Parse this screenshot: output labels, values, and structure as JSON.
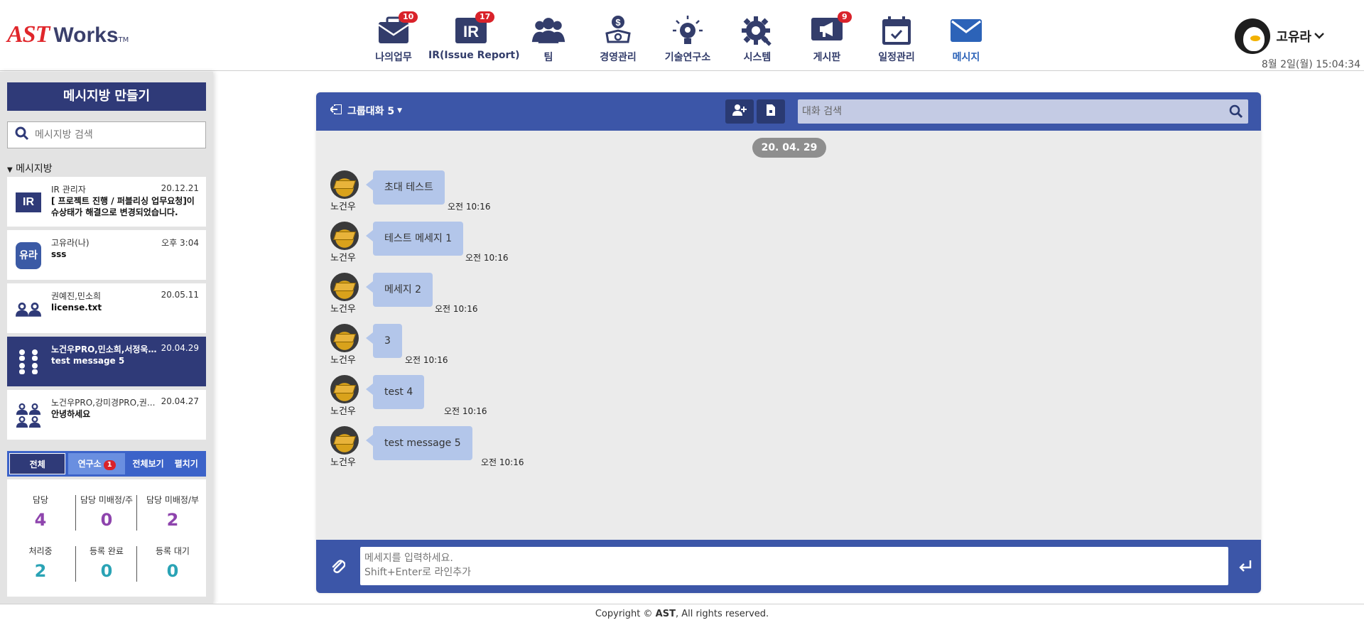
{
  "app": {
    "logo_main": "AST",
    "logo_works": "Works",
    "logo_tm": "TM"
  },
  "nav": [
    {
      "label": "나의업무",
      "badge": "10",
      "icon": "briefcase-icon"
    },
    {
      "label": "IR(Issue Report)",
      "badge": "17",
      "icon": "ir-icon"
    },
    {
      "label": "팀",
      "badge": "",
      "icon": "team-icon"
    },
    {
      "label": "경영관리",
      "badge": "",
      "icon": "management-icon"
    },
    {
      "label": "기술연구소",
      "badge": "",
      "icon": "research-icon"
    },
    {
      "label": "시스템",
      "badge": "",
      "icon": "gear-wrench-icon"
    },
    {
      "label": "게시판",
      "badge": "9",
      "icon": "megaphone-icon"
    },
    {
      "label": "일정관리",
      "badge": "",
      "icon": "calendar-icon"
    },
    {
      "label": "메시지",
      "badge": "",
      "icon": "mail-icon",
      "active": true
    }
  ],
  "user": {
    "name": "고유라",
    "clock": "8월 2일(월) 15:04:34"
  },
  "sidebar": {
    "make_room": "메시지방 만들기",
    "search_placeholder": "메시지방 검색",
    "section_label": "메시지방",
    "rooms": [
      {
        "name": "IR 관리자",
        "date": "20.12.21",
        "message": "[ 프로젝트 진행 / 퍼블리싱 업무요청]이 슈상태가 해결으로 변경되었습니다.",
        "icon_text": "IR",
        "active": false
      },
      {
        "name": "고유라(나)",
        "date": "오후 3:04",
        "message": "sss",
        "icon_text": "유라",
        "active": false
      },
      {
        "name": "권예진,민소희",
        "date": "20.05.11",
        "message": "license.txt",
        "icon_text": "",
        "active": false
      },
      {
        "name": "노건우PRO,민소희,서정욱...",
        "date": "20.04.29",
        "message": "test message 5",
        "icon_text": "",
        "active": true
      },
      {
        "name": "노건우PRO,강미경PRO,권...",
        "date": "20.04.27",
        "message": "안녕하세요",
        "icon_text": "",
        "active": false
      }
    ],
    "tabs": {
      "all": "전체",
      "lab": "연구소",
      "lab_badge": "1",
      "view_all": "전체보기",
      "expand": "펼치기"
    },
    "stats": [
      {
        "label": "담당",
        "value": "4"
      },
      {
        "label": "담당 미배정/주",
        "value": "0"
      },
      {
        "label": "담당 미배정/부",
        "value": "2"
      },
      {
        "label": "처리중",
        "value": "2"
      },
      {
        "label": "등록 완료",
        "value": "0"
      },
      {
        "label": "등록 대기",
        "value": "0"
      }
    ]
  },
  "chat": {
    "title": "그룹대화 5",
    "search_placeholder": "대화 검색",
    "date": "20. 04. 29",
    "messages": [
      {
        "sender": "노건우",
        "text": "초대 테스트",
        "time": "오전 10:16"
      },
      {
        "sender": "노건우",
        "text": "테스트 메세지 1",
        "time": "오전 10:16"
      },
      {
        "sender": "노건우",
        "text": "메세지 2",
        "time": "오전 10:16"
      },
      {
        "sender": "노건우",
        "text": "3",
        "time": "오전 10:16"
      },
      {
        "sender": "노건우",
        "text": "test 4",
        "time": "오전 10:16"
      },
      {
        "sender": "노건우",
        "text": "test message 5",
        "time": "오전 10:16"
      }
    ],
    "input_placeholder": "메세지를 입력하세요.\nShift+Enter로 라인추가"
  },
  "footer": {
    "prefix": "Copyright © ",
    "brand": "AST",
    "suffix": ", All rights reserved."
  },
  "colors": {
    "navy": "#2f3a78",
    "chat_blue": "#3c56a8",
    "bubble": "#b3c6ea",
    "badge_red": "#d9222a",
    "purple": "#8e44ad",
    "teal": "#2aa3b5"
  }
}
